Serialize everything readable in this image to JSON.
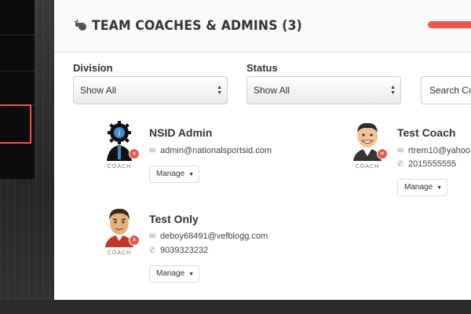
{
  "panel": {
    "title": "TEAM COACHES & ADMINS (3)"
  },
  "filters": {
    "division_label": "Division",
    "division_value": "Show All",
    "status_label": "Status",
    "status_value": "Show All",
    "search_placeholder": "Search Coa"
  },
  "coaches": [
    {
      "name": "NSID Admin",
      "role": "COACH",
      "email": "admin@nationalsportsid.com",
      "phone": "",
      "manage": "Manage",
      "avatar": "nsid-logo"
    },
    {
      "name": "Test Coach",
      "role": "COACH",
      "email": "rtrem10@yahoo",
      "phone": "2015555555",
      "manage": "Manage",
      "avatar": "cartoon-coach"
    },
    {
      "name": "Test Only",
      "role": "COACH",
      "email": "deboy68491@vefblogg.com",
      "phone": "9039323232",
      "manage": "Manage",
      "avatar": "cartoon-coach"
    }
  ],
  "colors": {
    "accent": "#e8594d",
    "panel_bg": "#ffffff",
    "nav_bg": "#0c0c0c"
  }
}
